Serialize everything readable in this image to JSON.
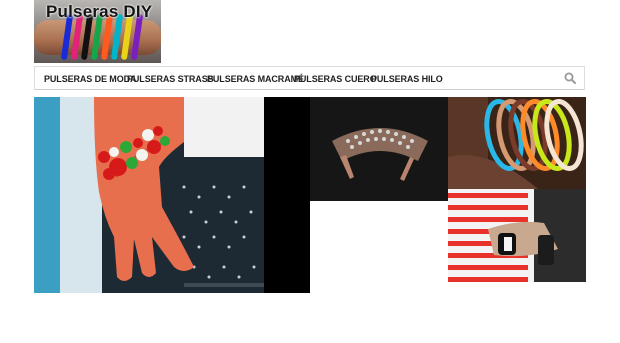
{
  "site": {
    "title": "Pulseras DIY"
  },
  "nav": {
    "items": [
      {
        "label": "PULSERAS DE MODA"
      },
      {
        "label": "PULSERAS STRASS"
      },
      {
        "label": "PULSERAS MACRAMÉ"
      },
      {
        "label": "PULSERAS CUERO"
      },
      {
        "label": "PULSERAS HILO"
      }
    ],
    "search_icon": "search-icon"
  },
  "featured": {
    "tiles": [
      {
        "name": "tile-button-bracelet",
        "icon": "photo"
      },
      {
        "name": "tile-studded-cuff",
        "icon": "photo"
      },
      {
        "name": "tile-neon-bangles",
        "icon": "photo"
      },
      {
        "name": "tile-stripe-cuff",
        "icon": "photo"
      }
    ]
  },
  "colors": {
    "nav_border": "#dedede",
    "text": "#222222",
    "icon": "#9a9a9a"
  }
}
